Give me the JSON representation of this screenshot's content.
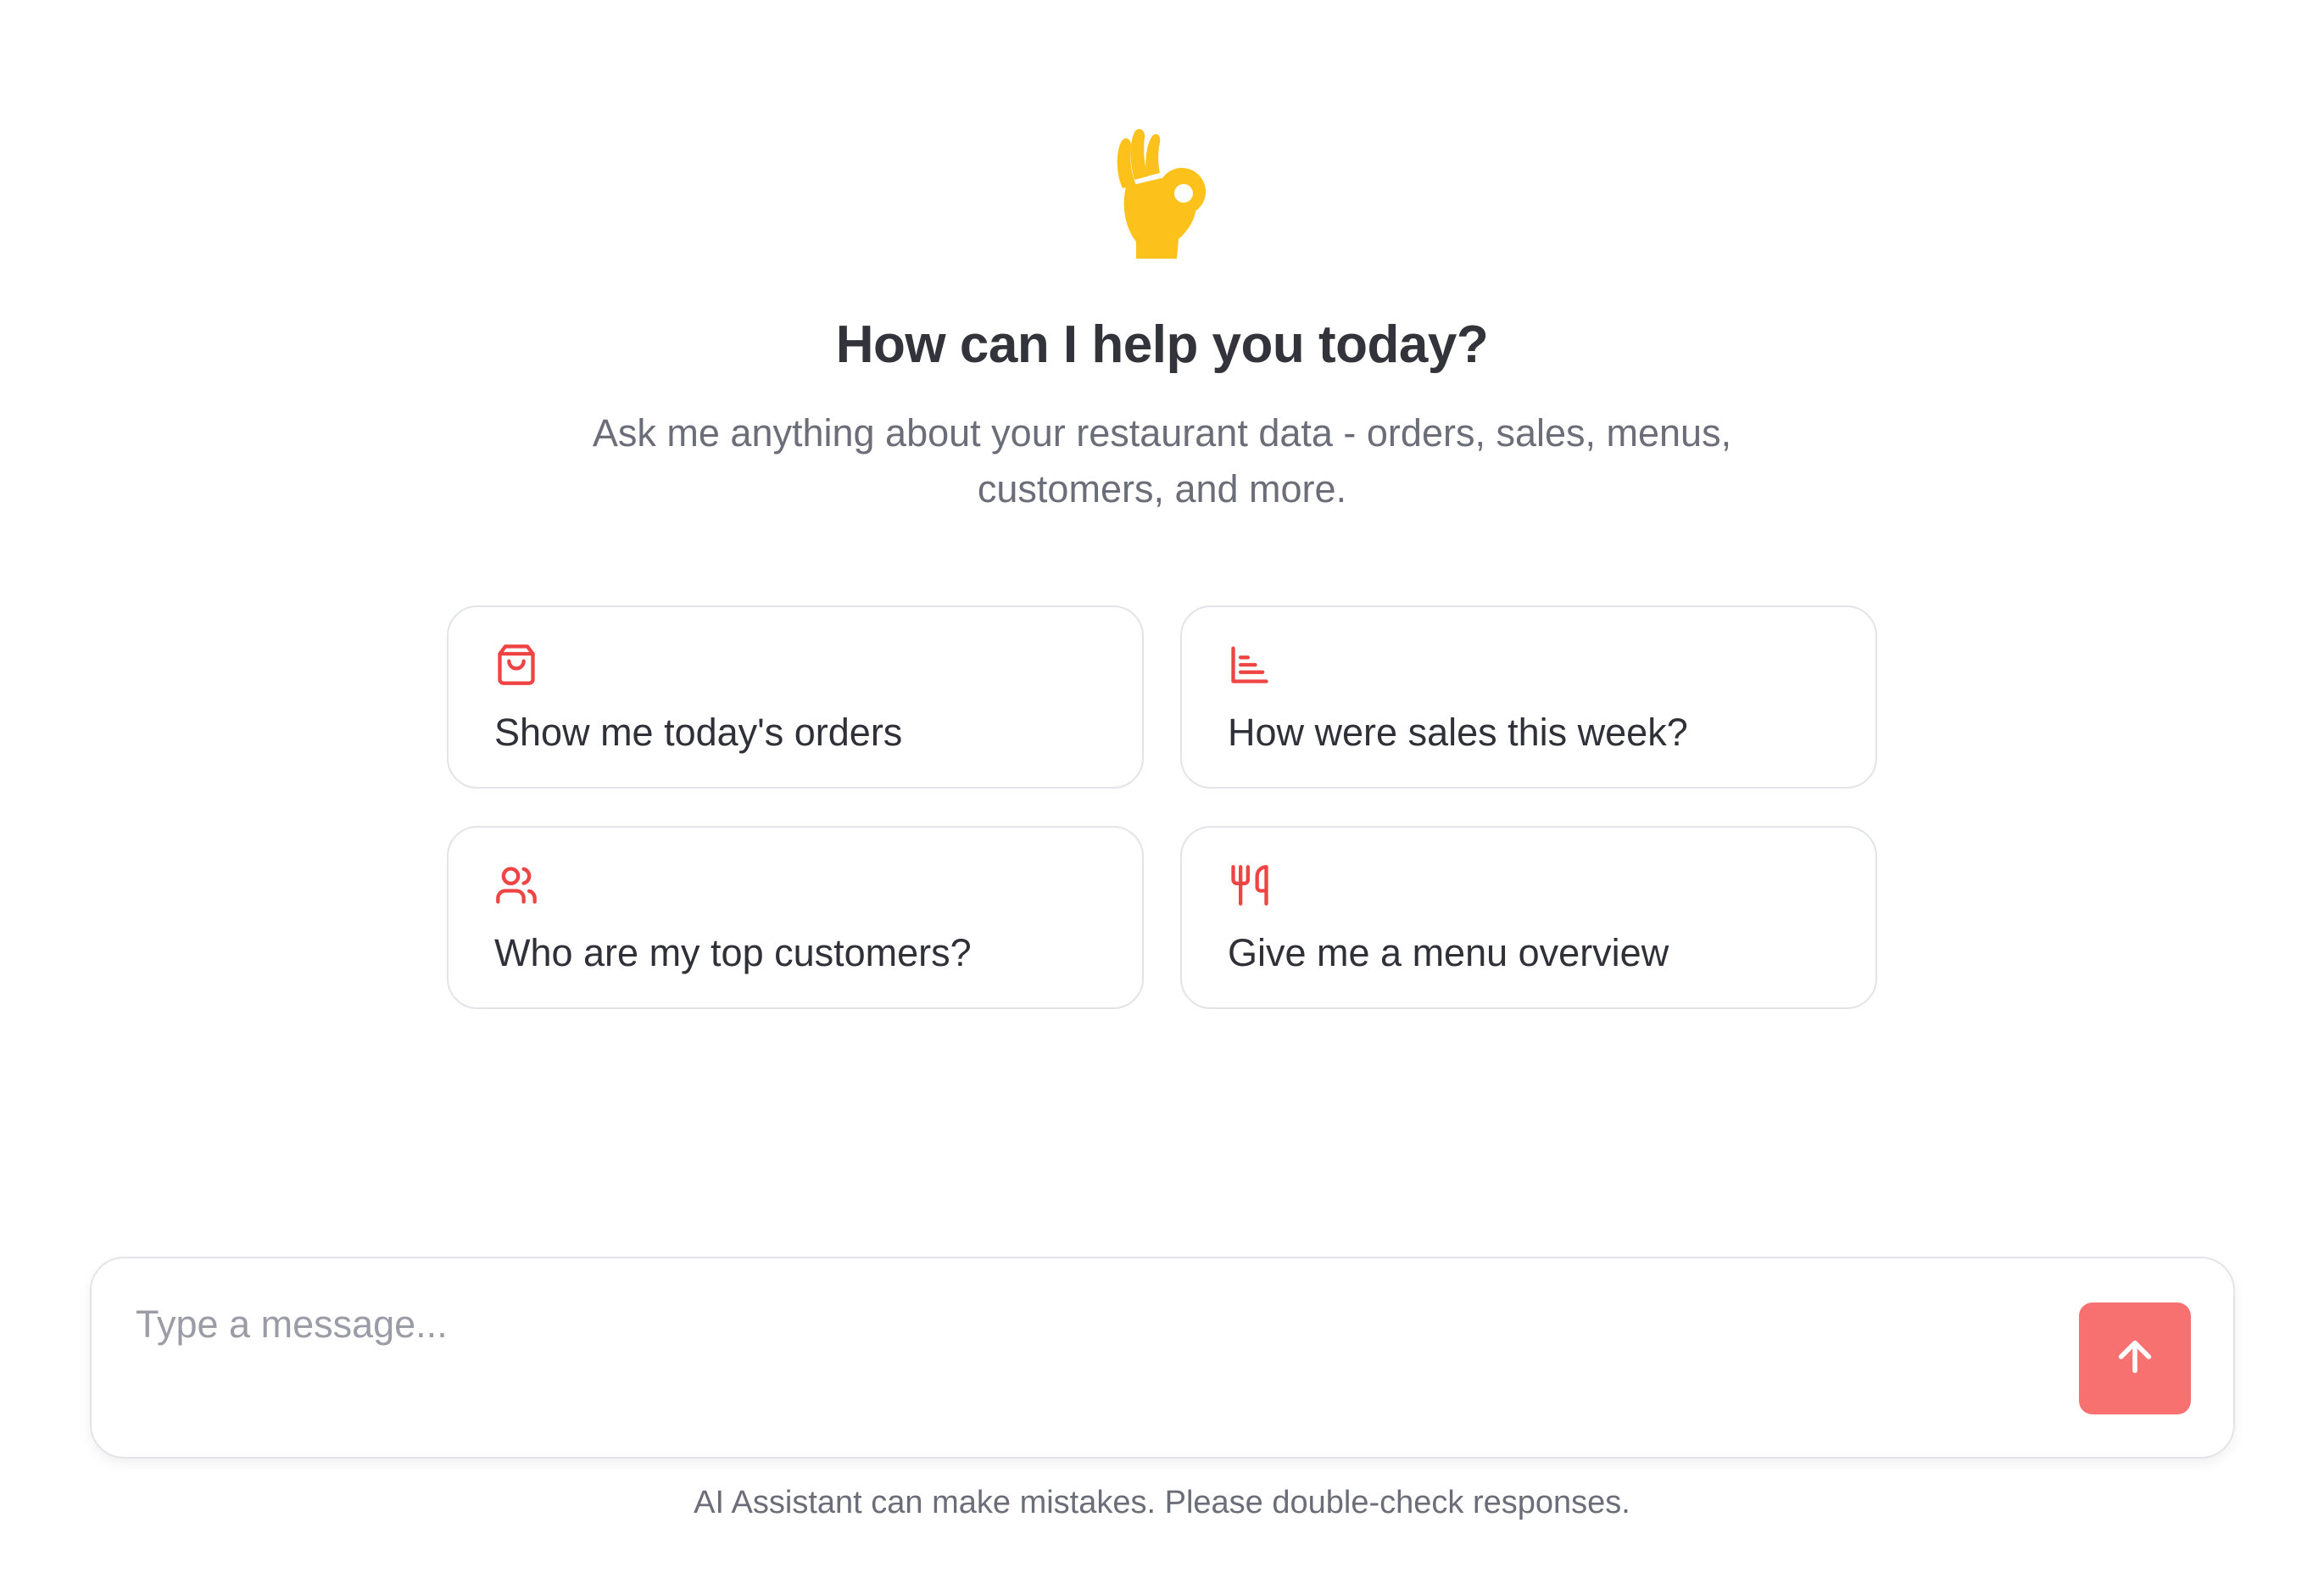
{
  "hero": {
    "emoji_icon": "ok-hand-icon",
    "title": "How can I help you today?",
    "subtitle": "Ask me anything about your restaurant data - orders, sales, menus, customers, and more."
  },
  "suggestions": [
    {
      "icon": "shopping-bag-icon",
      "label": "Show me today's orders"
    },
    {
      "icon": "bar-chart-icon",
      "label": "How were sales this week?"
    },
    {
      "icon": "users-icon",
      "label": "Who are my top customers?"
    },
    {
      "icon": "utensils-icon",
      "label": "Give me a menu overview"
    }
  ],
  "composer": {
    "placeholder": "Type a message...",
    "value": "",
    "send_icon": "arrow-up-icon"
  },
  "footer": {
    "disclaimer": "AI Assistant can make mistakes. Please double-check responses."
  },
  "colors": {
    "accent": "#f87171",
    "icon_accent": "#ef4444",
    "emoji": "#fcc21b",
    "title": "#33343b",
    "muted_text": "#6b6e78",
    "border": "#e3e4e8"
  }
}
